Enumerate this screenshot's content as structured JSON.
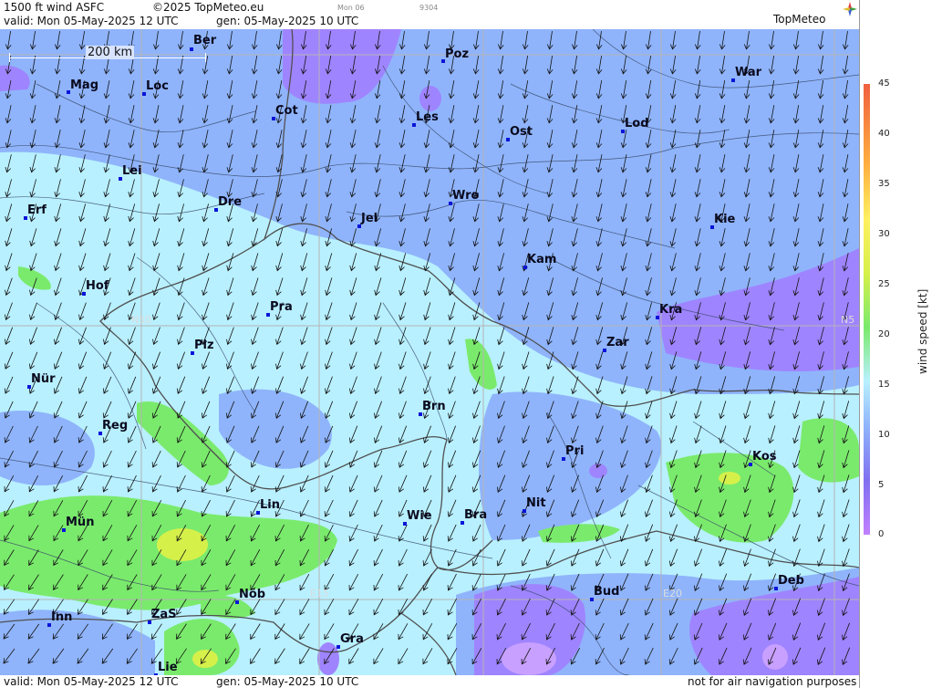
{
  "header": {
    "title": "1500 ft wind ASFC",
    "copyright": "©2025 TopMeteo.eu",
    "small_day": "Mon 06",
    "small_code": "9304",
    "valid": "valid:  Mon  05-May-2025  12 UTC",
    "generated": "gen:  05-May-2025 10 UTC",
    "brand": "TopMeteo"
  },
  "footer": {
    "valid": "valid:  Mon  05-May-2025  12 UTC",
    "generated": "gen:  05-May-2025 10 UTC",
    "disclaimer": "not for air navigation purposes"
  },
  "scale": {
    "label": "200 km"
  },
  "grid_labels": {
    "n50_left": "N50",
    "n50_right": "N5",
    "e15": "E15",
    "e20": "E20"
  },
  "legend": {
    "unit": "wind  speed  [kt]",
    "ticks": [
      "45",
      "40",
      "35",
      "30",
      "25",
      "20",
      "15",
      "10",
      "5",
      "0"
    ],
    "colors": [
      "#c080ff",
      "#8070f0",
      "#8fb4fb",
      "#b8f0ff",
      "#7aea6c",
      "#d6f04a",
      "#fff060",
      "#ffb040",
      "#f06040"
    ]
  },
  "cities": [
    {
      "name": "Ber"
    },
    {
      "name": "Poz"
    },
    {
      "name": "War"
    },
    {
      "name": "Mag"
    },
    {
      "name": "Loc"
    },
    {
      "name": "Cot"
    },
    {
      "name": "Les"
    },
    {
      "name": "Ost"
    },
    {
      "name": "Lod"
    },
    {
      "name": "Lei"
    },
    {
      "name": "Erf"
    },
    {
      "name": "Dre"
    },
    {
      "name": "Jel"
    },
    {
      "name": "Wro"
    },
    {
      "name": "Kie"
    },
    {
      "name": "Kam"
    },
    {
      "name": "Hof"
    },
    {
      "name": "Pra"
    },
    {
      "name": "Kra"
    },
    {
      "name": "Plz"
    },
    {
      "name": "Zar"
    },
    {
      "name": "Nür"
    },
    {
      "name": "Brn"
    },
    {
      "name": "Reg"
    },
    {
      "name": "Pri"
    },
    {
      "name": "Kos"
    },
    {
      "name": "Lin"
    },
    {
      "name": "Nit"
    },
    {
      "name": "Mün"
    },
    {
      "name": "Wie"
    },
    {
      "name": "Bra"
    },
    {
      "name": "Deb"
    },
    {
      "name": "Bud"
    },
    {
      "name": "Nöb"
    },
    {
      "name": "Inn"
    },
    {
      "name": "ZaS"
    },
    {
      "name": "Gra"
    },
    {
      "name": "Lie"
    }
  ]
}
